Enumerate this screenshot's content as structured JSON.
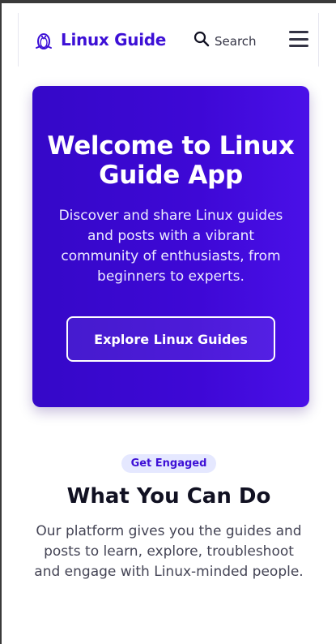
{
  "header": {
    "brand_name": "Linux Guide",
    "brand_icon": "tux-penguin-icon",
    "search_label": "Search",
    "search_icon": "search-icon",
    "menu_icon": "hamburger-menu-icon"
  },
  "hero": {
    "title": "Welcome to Linux Guide App",
    "description": "Discover and share Linux guides and posts with a vibrant community of enthusiasts, from beginners to experts.",
    "cta_label": "Explore Linux Guides"
  },
  "engage": {
    "badge": "Get Engaged",
    "title": "What You Can Do",
    "description": "Our platform gives you the guides and posts to learn, explore, troubleshoot and engage with Linux-minded people."
  },
  "colors": {
    "brand": "#3d10d6",
    "hero_gradient_start": "#3508c8",
    "hero_gradient_end": "#4a10e8",
    "badge_bg": "#e5e8ff"
  }
}
